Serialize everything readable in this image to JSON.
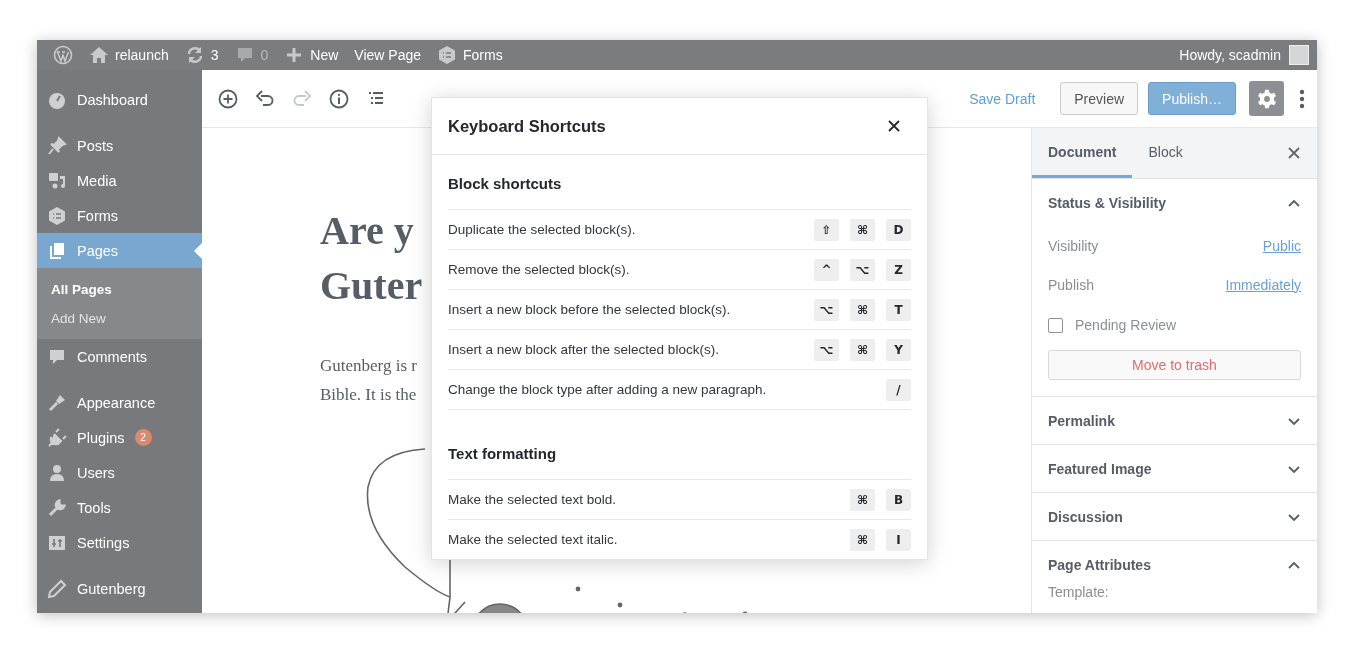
{
  "admin_bar": {
    "items": [
      {
        "kind": "logo"
      },
      {
        "kind": "home",
        "label": "relaunch"
      },
      {
        "kind": "updates",
        "label": "3"
      },
      {
        "kind": "comments",
        "label": "0"
      },
      {
        "kind": "new",
        "label": "New"
      },
      {
        "kind": "text",
        "label": "View Page"
      },
      {
        "kind": "forms",
        "label": "Forms"
      }
    ],
    "greeting": "Howdy, scadmin"
  },
  "sidebar": {
    "groups": [
      {
        "items": [
          {
            "kind": "dashboard",
            "label": "Dashboard",
            "selected": false
          }
        ]
      },
      {
        "items": [
          {
            "kind": "posts",
            "label": "Posts",
            "selected": false
          },
          {
            "kind": "media",
            "label": "Media",
            "selected": false
          },
          {
            "kind": "forms",
            "label": "Forms",
            "selected": false
          },
          {
            "kind": "pages",
            "label": "Pages",
            "selected": true,
            "children": [
              {
                "label": "All Pages",
                "selected": true
              },
              {
                "label": "Add New",
                "selected": false
              }
            ]
          },
          {
            "kind": "comments",
            "label": "Comments",
            "selected": false
          }
        ]
      },
      {
        "items": [
          {
            "kind": "appearance",
            "label": "Appearance",
            "selected": false
          },
          {
            "kind": "plugins",
            "label": "Plugins",
            "selected": false,
            "badge": "2"
          },
          {
            "kind": "users",
            "label": "Users",
            "selected": false
          },
          {
            "kind": "tools",
            "label": "Tools",
            "selected": false
          },
          {
            "kind": "settings",
            "label": "Settings",
            "selected": false
          }
        ]
      },
      {
        "items": [
          {
            "kind": "gutenberg",
            "label": "Gutenberg",
            "selected": false
          }
        ]
      }
    ]
  },
  "toolbar": {
    "tools": [
      {
        "kind": "inserter",
        "disabled": false
      },
      {
        "kind": "undo",
        "disabled": false
      },
      {
        "kind": "redo",
        "disabled": true
      },
      {
        "kind": "info",
        "disabled": false
      },
      {
        "kind": "outline",
        "disabled": false
      }
    ],
    "save_draft": "Save Draft",
    "preview": "Preview",
    "publish": "Publish…",
    "settings_toggle": {
      "on": true
    }
  },
  "content": {
    "title_lines": [
      "Are y",
      "Guter"
    ],
    "paragraph_lines": [
      "Gutenberg is r",
      "Bible. It is the"
    ]
  },
  "settings_panel": {
    "tabs": [
      {
        "label": "Document",
        "selected": true
      },
      {
        "label": "Block",
        "selected": false
      }
    ],
    "sections": [
      {
        "title": "Status & Visibility",
        "expanded": true,
        "items": [
          {
            "kind": "link_row",
            "label": "Visibility",
            "value": "Public"
          },
          {
            "kind": "link_row",
            "label": "Publish",
            "value": "Immediately"
          },
          {
            "kind": "checkbox",
            "label": "Pending Review",
            "checked": false
          },
          {
            "kind": "danger_button",
            "label": "Move to trash"
          }
        ]
      },
      {
        "title": "Permalink",
        "expanded": false
      },
      {
        "title": "Featured Image",
        "expanded": false
      },
      {
        "title": "Discussion",
        "expanded": false
      },
      {
        "title": "Page Attributes",
        "expanded": true,
        "items": [
          {
            "kind": "label",
            "label": "Template:"
          }
        ]
      }
    ]
  },
  "modal": {
    "title": "Keyboard Shortcuts",
    "groups": [
      {
        "title": "Block shortcuts",
        "shortcuts": [
          {
            "description": "Duplicate the selected block(s).",
            "keys": [
              "⇧",
              "⌘",
              "D"
            ]
          },
          {
            "description": "Remove the selected block(s).",
            "keys": [
              "^",
              "⌥",
              "Z"
            ]
          },
          {
            "description": "Insert a new block before the selected block(s).",
            "keys": [
              "⌥",
              "⌘",
              "T"
            ]
          },
          {
            "description": "Insert a new block after the selected block(s).",
            "keys": [
              "⌥",
              "⌘",
              "Y"
            ]
          },
          {
            "description": "Change the block type after adding a new paragraph.",
            "keys": [
              "/"
            ]
          }
        ]
      },
      {
        "title": "Text formatting",
        "shortcuts": [
          {
            "description": "Make the selected text bold.",
            "keys": [
              "⌘",
              "B"
            ]
          },
          {
            "description": "Make the selected text italic.",
            "keys": [
              "⌘",
              "I"
            ]
          }
        ]
      }
    ]
  }
}
